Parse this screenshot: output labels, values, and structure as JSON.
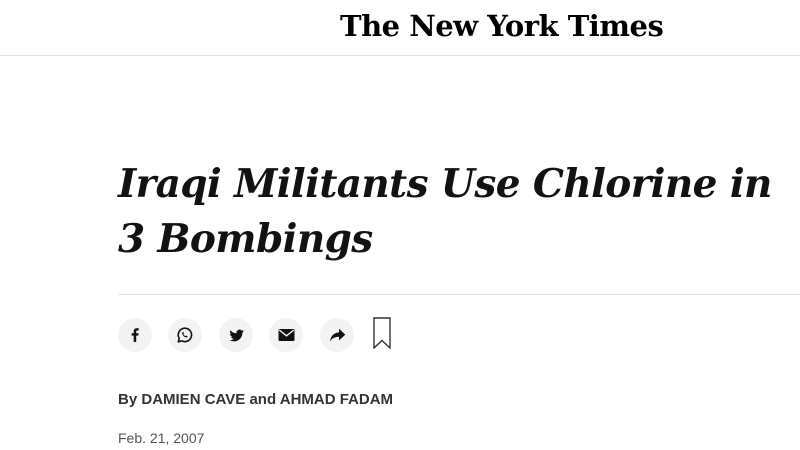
{
  "masthead": {
    "logo_text": "The New York Times"
  },
  "article": {
    "headline": "Iraqi Militants Use Chlorine in 3 Bombings",
    "byline": {
      "prefix": "By",
      "author_1": "DAMIEN CAVE",
      "conjunction": "and",
      "author_2": "AHMAD FADAM"
    },
    "date": "Feb. 21, 2007"
  },
  "share_bar": {
    "buttons": [
      {
        "icon": "facebook-icon"
      },
      {
        "icon": "whatsapp-icon"
      },
      {
        "icon": "twitter-icon"
      },
      {
        "icon": "email-icon"
      },
      {
        "icon": "share-arrow-icon"
      }
    ],
    "save_icon": "bookmark-icon"
  },
  "colors": {
    "text": "#121212",
    "button_bg": "#f3f3f3",
    "divider": "#dfdfdf"
  }
}
